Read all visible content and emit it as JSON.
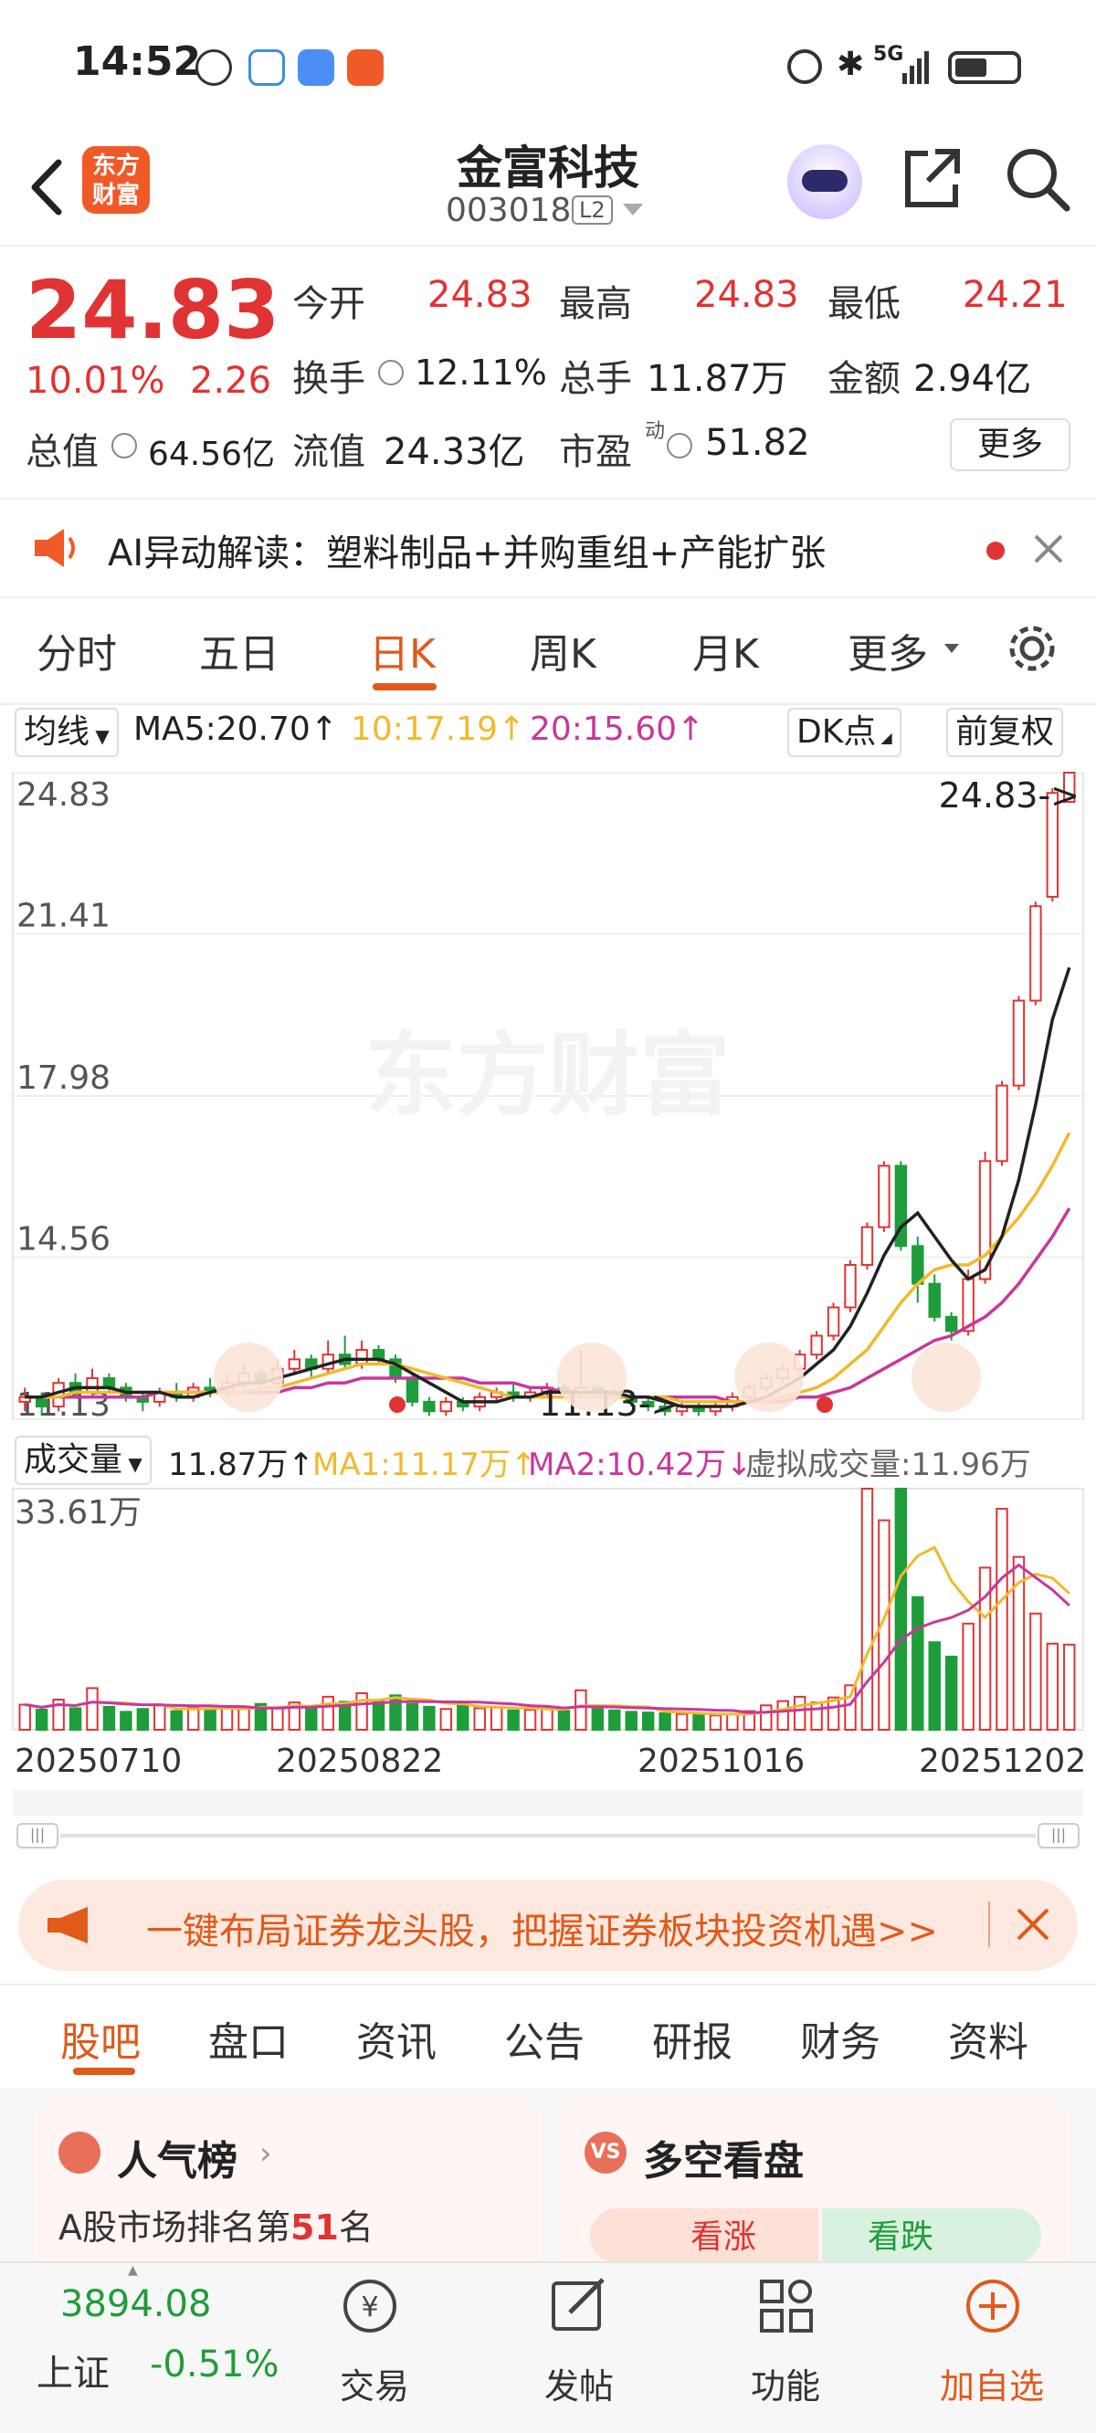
{
  "status": {
    "time": "14:52",
    "network": "5G"
  },
  "header": {
    "back": "‹",
    "logo": "东方财富",
    "name": "金富科技",
    "code": "003018",
    "level": "L2"
  },
  "quote": {
    "price": "24.83",
    "change_pct": "10.01%",
    "change": "2.26",
    "open_label": "今开",
    "open": "24.83",
    "high_label": "最高",
    "high": "24.83",
    "low_label": "最低",
    "low": "24.21",
    "turnover_label": "换手",
    "turnover": "12.11%",
    "volume_label": "总手",
    "volume": "11.87万",
    "amount_label": "金额",
    "amount": "2.94亿",
    "mktcap_label": "总值",
    "mktcap": "64.56亿",
    "float_label": "流值",
    "float": "24.33亿",
    "pe_label": "市盈",
    "pe_sup": "动",
    "pe": "51.82",
    "more": "更多"
  },
  "ai_banner": {
    "text": "AI异动解读：塑料制品+并购重组+产能扩张"
  },
  "tabs": [
    "分时",
    "五日",
    "日K",
    "周K",
    "月K",
    "更多"
  ],
  "kline_header": {
    "type": "均线",
    "ma5": "MA5:20.70↑",
    "ma10": "10:17.19↑",
    "ma20": "20:15.60↑",
    "dk": "DK点",
    "adj": "前复权"
  },
  "kline": {
    "y_labels": [
      "24.83",
      "21.41",
      "17.98",
      "14.56",
      "11.13"
    ],
    "price_marker": "24.83->",
    "low_marker": "11.13->",
    "watermark": "东方财富"
  },
  "volume_header": {
    "type": "成交量",
    "vol": "11.87万↑",
    "ma1": "MA1:11.17万↑",
    "ma2": "MA2:10.42万↓",
    "virtual": "虚拟成交量:11.96万"
  },
  "volume": {
    "max_label": "33.61万"
  },
  "x_labels": [
    "20250710",
    "20250822",
    "20251016",
    "20251202"
  ],
  "promo": {
    "text": "一键布局证券龙头股，把握证券板块投资机遇>>"
  },
  "bottom_tabs": [
    "股吧",
    "盘口",
    "资讯",
    "公告",
    "研报",
    "财务",
    "资料"
  ],
  "cards": {
    "popularity_title": "人气榜",
    "popularity_text": "A股市场排名第",
    "popularity_rank": "51",
    "popularity_unit": "名",
    "dk_title": "多空看盘",
    "bull": "看涨",
    "bear": "看跌"
  },
  "index": {
    "value": "3894.08",
    "name": "上证",
    "change": "-0.51%"
  },
  "nav": [
    "交易",
    "发帖",
    "功能",
    "加自选"
  ],
  "colors": {
    "up": "#e03333",
    "down": "#1f9d3a",
    "accent": "#e05a1c",
    "ma5": "#222222",
    "ma10": "#f2b92e",
    "ma20": "#c9379c"
  },
  "chart_data": {
    "type": "candlestick",
    "ylim": [
      11.13,
      24.83
    ],
    "candles": [
      [
        11.5,
        11.6,
        11.3,
        11.8
      ],
      [
        11.6,
        11.4,
        11.2,
        11.7
      ],
      [
        11.4,
        11.9,
        11.3,
        12.0
      ],
      [
        11.9,
        11.7,
        11.6,
        12.1
      ],
      [
        11.7,
        12.0,
        11.6,
        12.2
      ],
      [
        12.0,
        11.8,
        11.7,
        12.1
      ],
      [
        11.8,
        11.6,
        11.5,
        11.9
      ],
      [
        11.6,
        11.5,
        11.3,
        11.7
      ],
      [
        11.5,
        11.7,
        11.4,
        11.8
      ],
      [
        11.7,
        11.6,
        11.5,
        11.9
      ],
      [
        11.6,
        11.8,
        11.5,
        11.9
      ],
      [
        11.8,
        11.7,
        11.6,
        12.0
      ],
      [
        11.7,
        11.9,
        11.6,
        12.1
      ],
      [
        11.9,
        12.1,
        11.8,
        12.3
      ],
      [
        12.1,
        11.9,
        11.8,
        12.2
      ],
      [
        11.9,
        12.2,
        11.8,
        12.4
      ],
      [
        12.2,
        12.4,
        12.1,
        12.6
      ],
      [
        12.4,
        12.2,
        12.0,
        12.5
      ],
      [
        12.2,
        12.5,
        12.1,
        12.8
      ],
      [
        12.5,
        12.3,
        12.2,
        12.9
      ],
      [
        12.3,
        12.6,
        12.2,
        12.8
      ],
      [
        12.6,
        12.4,
        12.3,
        12.7
      ],
      [
        12.4,
        12.0,
        11.9,
        12.5
      ],
      [
        12.0,
        11.5,
        11.4,
        12.1
      ],
      [
        11.5,
        11.3,
        11.2,
        11.6
      ],
      [
        11.3,
        11.5,
        11.2,
        11.6
      ],
      [
        11.5,
        11.4,
        11.3,
        11.6
      ],
      [
        11.4,
        11.6,
        11.3,
        11.7
      ],
      [
        11.6,
        11.7,
        11.5,
        11.8
      ],
      [
        11.7,
        11.6,
        11.5,
        11.9
      ],
      [
        11.6,
        11.7,
        11.5,
        11.8
      ],
      [
        11.7,
        11.8,
        11.6,
        11.9
      ],
      [
        11.8,
        11.7,
        11.6,
        11.9
      ],
      [
        11.7,
        11.8,
        11.6,
        12.6
      ],
      [
        11.8,
        11.7,
        11.6,
        11.9
      ],
      [
        11.7,
        11.6,
        11.5,
        11.8
      ],
      [
        11.6,
        11.5,
        11.4,
        11.7
      ],
      [
        11.5,
        11.4,
        11.3,
        11.6
      ],
      [
        11.4,
        11.3,
        11.2,
        11.5
      ],
      [
        11.3,
        11.4,
        11.2,
        11.5
      ],
      [
        11.4,
        11.3,
        11.2,
        11.5
      ],
      [
        11.3,
        11.4,
        11.2,
        11.5
      ],
      [
        11.4,
        11.6,
        11.3,
        11.7
      ],
      [
        11.6,
        11.8,
        11.5,
        11.9
      ],
      [
        11.8,
        12.0,
        11.7,
        12.1
      ],
      [
        12.0,
        12.2,
        11.9,
        12.3
      ],
      [
        12.2,
        12.5,
        12.1,
        12.6
      ],
      [
        12.5,
        12.9,
        12.4,
        13.0
      ],
      [
        12.9,
        13.5,
        12.8,
        13.6
      ],
      [
        13.5,
        14.4,
        13.4,
        14.5
      ],
      [
        14.4,
        15.2,
        14.3,
        15.3
      ],
      [
        15.2,
        16.5,
        15.1,
        16.6
      ],
      [
        16.5,
        14.8,
        14.7,
        16.6
      ],
      [
        14.8,
        14.0,
        13.6,
        15.0
      ],
      [
        14.0,
        13.3,
        13.2,
        14.2
      ],
      [
        13.3,
        13.0,
        12.8,
        13.4
      ],
      [
        13.0,
        14.1,
        12.9,
        14.3
      ],
      [
        14.1,
        16.6,
        14.0,
        16.8
      ],
      [
        16.6,
        18.2,
        16.5,
        18.3
      ],
      [
        18.2,
        20.0,
        18.1,
        20.1
      ],
      [
        20.0,
        22.0,
        19.9,
        22.1
      ],
      [
        22.2,
        24.4,
        22.1,
        24.5
      ],
      [
        24.21,
        24.83,
        24.21,
        24.83
      ]
    ],
    "ma5": [
      11.6,
      11.6,
      11.7,
      11.8,
      11.8,
      11.8,
      11.7,
      11.7,
      11.7,
      11.6,
      11.6,
      11.7,
      11.8,
      11.9,
      11.9,
      12.0,
      12.1,
      12.2,
      12.3,
      12.4,
      12.4,
      12.4,
      12.3,
      12.1,
      11.9,
      11.7,
      11.5,
      11.5,
      11.5,
      11.6,
      11.6,
      11.7,
      11.7,
      11.7,
      11.7,
      11.7,
      11.6,
      11.6,
      11.5,
      11.4,
      11.4,
      11.4,
      11.4,
      11.5,
      11.6,
      11.8,
      12.0,
      12.3,
      12.6,
      13.1,
      13.8,
      14.6,
      15.2,
      15.5,
      15.0,
      14.5,
      14.1,
      14.3,
      15.0,
      16.2,
      17.8,
      19.6,
      20.7
    ],
    "ma10": [
      11.6,
      11.6,
      11.6,
      11.7,
      11.7,
      11.7,
      11.7,
      11.7,
      11.7,
      11.7,
      11.7,
      11.7,
      11.7,
      11.7,
      11.8,
      11.8,
      11.9,
      12.0,
      12.1,
      12.2,
      12.3,
      12.3,
      12.3,
      12.2,
      12.1,
      12.0,
      11.9,
      11.8,
      11.7,
      11.6,
      11.6,
      11.6,
      11.6,
      11.6,
      11.6,
      11.6,
      11.6,
      11.6,
      11.6,
      11.5,
      11.5,
      11.5,
      11.5,
      11.5,
      11.5,
      11.6,
      11.7,
      11.8,
      12.0,
      12.3,
      12.6,
      13.1,
      13.6,
      14.0,
      14.3,
      14.4,
      14.4,
      14.6,
      15.0,
      15.4,
      15.9,
      16.5,
      17.2
    ],
    "ma20": [
      11.6,
      11.6,
      11.6,
      11.6,
      11.6,
      11.6,
      11.6,
      11.6,
      11.7,
      11.7,
      11.7,
      11.7,
      11.7,
      11.7,
      11.7,
      11.7,
      11.8,
      11.8,
      11.9,
      11.9,
      12.0,
      12.0,
      12.0,
      12.0,
      12.0,
      12.0,
      12.0,
      11.9,
      11.9,
      11.9,
      11.8,
      11.8,
      11.7,
      11.7,
      11.7,
      11.7,
      11.6,
      11.6,
      11.6,
      11.6,
      11.6,
      11.6,
      11.5,
      11.5,
      11.5,
      11.5,
      11.6,
      11.6,
      11.7,
      11.8,
      12.0,
      12.2,
      12.4,
      12.6,
      12.8,
      12.9,
      13.1,
      13.3,
      13.6,
      14.0,
      14.5,
      15.0,
      15.6
    ],
    "volume_ylim": [
      0,
      33.61
    ],
    "volume": [
      3.5,
      2.8,
      4.2,
      3.0,
      5.8,
      3.2,
      2.5,
      2.9,
      3.4,
      2.6,
      3.1,
      2.7,
      3.3,
      2.9,
      3.6,
      3.0,
      3.8,
      3.1,
      4.6,
      3.9,
      5.1,
      4.0,
      4.8,
      3.6,
      3.2,
      2.9,
      3.5,
      3.0,
      3.1,
      2.7,
      2.8,
      3.0,
      2.6,
      5.5,
      2.9,
      2.7,
      2.5,
      2.4,
      2.3,
      2.2,
      2.1,
      2.0,
      2.2,
      2.6,
      3.4,
      4.0,
      4.6,
      3.8,
      4.5,
      6.2,
      33.61,
      29.2,
      33.61,
      18.5,
      12.2,
      10.2,
      14.8,
      22.6,
      30.8,
      24.1,
      16.2,
      12.0,
      11.87
    ]
  }
}
